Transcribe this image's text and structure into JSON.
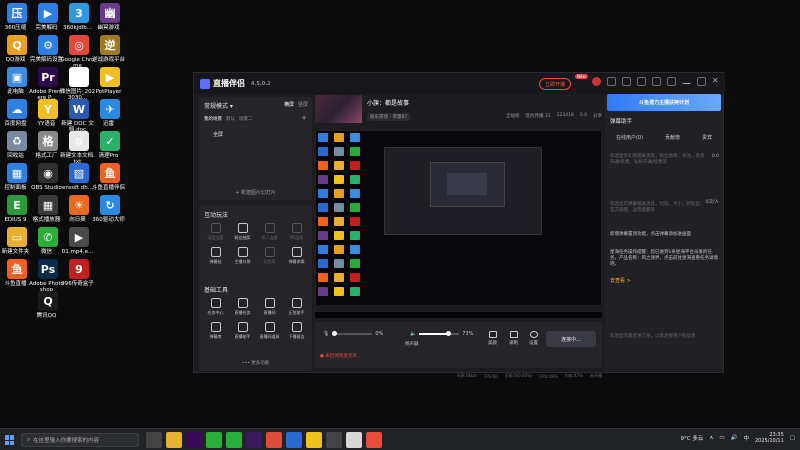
{
  "desktop": {
    "icons": [
      {
        "label": "360压缩",
        "color": "#2d7fe0",
        "glyph": "压"
      },
      {
        "label": "QQ游戏",
        "color": "#e8a020",
        "glyph": "Q"
      },
      {
        "label": "此电脑",
        "color": "#3b8be0",
        "glyph": "▣"
      },
      {
        "label": "百度网盘",
        "color": "#2d7fe0",
        "glyph": "☁"
      },
      {
        "label": "回收站",
        "color": "#7a8aa0",
        "glyph": "♻"
      },
      {
        "label": "控制面板",
        "color": "#2d7fe0",
        "glyph": "▦"
      },
      {
        "label": "EDIUS 9",
        "color": "#2a9a3a",
        "glyph": "E"
      },
      {
        "label": "新建文件夹",
        "color": "#e8b030",
        "glyph": "▭"
      },
      {
        "label": "斗鱼直播",
        "color": "#f06020",
        "glyph": "鱼"
      },
      {
        "label": "完美解码",
        "color": "#2d7fe0",
        "glyph": "▶"
      },
      {
        "label": "完美解码设置",
        "color": "#2d7fe0",
        "glyph": "⚙"
      },
      {
        "label": "Adobe Premiere P...",
        "color": "#2a0a4a",
        "glyph": "Pr"
      },
      {
        "label": "YY语音",
        "color": "#f0c020",
        "glyph": "Y"
      },
      {
        "label": "格式工厂",
        "color": "#8a8a8a",
        "glyph": "格"
      },
      {
        "label": "OBS Studio",
        "color": "#302e31",
        "glyph": "◉"
      },
      {
        "label": "格式播放器",
        "color": "#3a3a3a",
        "glyph": "▦"
      },
      {
        "label": "微信",
        "color": "#2aae3a",
        "glyph": "✆"
      },
      {
        "label": "Adobe Photoshop",
        "color": "#0a2a4a",
        "glyph": "Ps"
      },
      {
        "label": "腾讯QQ",
        "color": "#1a1a1a",
        "glyph": "Q"
      },
      {
        "label": "360kjdlb...",
        "color": "#2d9ae0",
        "glyph": "3"
      },
      {
        "label": "Google Chrome",
        "color": "#e04a3a",
        "glyph": "◎"
      },
      {
        "label": "微信图片_2023030...",
        "color": "#ffffff",
        "glyph": ""
      },
      {
        "label": "新建 DOC 文档.doc",
        "color": "#2a5ab0",
        "glyph": "W"
      },
      {
        "label": "新建文本文档.txt",
        "color": "#e8e8e8",
        "glyph": "≡"
      },
      {
        "label": "ensoft dh...",
        "color": "#2a6ad0",
        "glyph": "▧"
      },
      {
        "label": "向日葵",
        "color": "#e86a20",
        "glyph": "☀"
      },
      {
        "label": "01.mp4.e...",
        "color": "#4a4a4a",
        "glyph": "▶"
      },
      {
        "label": "996传奇盒子",
        "color": "#c02020",
        "glyph": "9"
      },
      {
        "label": "幽冥游戏",
        "color": "#6a3a8a",
        "glyph": "幽"
      },
      {
        "label": "逆战游戏平台",
        "color": "#a07a20",
        "glyph": "逆"
      },
      {
        "label": "PotPlayer",
        "color": "#f0c020",
        "glyph": "▶"
      },
      {
        "label": "迅雷",
        "color": "#2a8ae0",
        "glyph": "✈"
      },
      {
        "label": "清理Pro",
        "color": "#2ab06a",
        "glyph": "✓"
      },
      {
        "label": "斗鱼直播伴侣",
        "color": "#f06020",
        "glyph": "鱼"
      },
      {
        "label": "360驱动大师",
        "color": "#2a8ae0",
        "glyph": "↻"
      }
    ]
  },
  "app": {
    "name": "直播伴侣",
    "version": "4.5.0.2",
    "live_button": "立即开播",
    "new_badge": "New",
    "left": {
      "mode": "常规模式 ▾",
      "mode_tabs": [
        "横屏",
        "竖屏"
      ],
      "scene_tabs": [
        "我的场景",
        "默认",
        "场景二"
      ],
      "scene_item": "全屏",
      "add_scene": "+ 新建图片幻灯片",
      "interact_title": "互动玩法",
      "interact_items": [
        {
          "label": "语音连麦",
          "dim": true
        },
        {
          "label": "粉丝抽奖",
          "dim": false
        },
        {
          "label": "多人连麦",
          "dim": true
        },
        {
          "label": "PK连线",
          "dim": true
        },
        {
          "label": "弹幕挂",
          "dim": false
        },
        {
          "label": "主播口袋",
          "dim": false
        },
        {
          "label": "红包雨",
          "dim": true
        },
        {
          "label": "弹幕求歌",
          "dim": false
        }
      ],
      "tools_title": "基础工具",
      "tools_items": [
        {
          "label": "任务中心",
          "dim": false
        },
        {
          "label": "直播任务",
          "dim": false
        },
        {
          "label": "直播间",
          "dim": false
        },
        {
          "label": "正弦助手",
          "dim": false
        },
        {
          "label": "弹幕库",
          "dim": false
        },
        {
          "label": "直播助手",
          "dim": false
        },
        {
          "label": "直播间道具",
          "dim": false
        },
        {
          "label": "下播报告",
          "dim": false
        }
      ],
      "more": "••• 更多功能"
    },
    "center": {
      "room_title": "小旗：都是故事",
      "category": "极乐游戏 - 草量87",
      "stats": [
        "全站榜",
        "签约月播 31",
        "223418",
        "0.0",
        "分享"
      ],
      "mic_value": "0%",
      "speaker_value": "73%",
      "mic_label": "麦克风",
      "speaker_label": "扬声器",
      "ctl": [
        "美颜",
        "录制",
        "设置"
      ],
      "connect_button": "连接中...",
      "warn": "● 未检测到麦克风",
      "status": [
        "码率:0kb/s",
        "FPS:60",
        "丢帧:0(0.00%)",
        "CPU:19%",
        "内存:47%",
        "未开播"
      ]
    },
    "right": {
      "banner": "斗鱼潜力主播扶持计划",
      "title": "弹幕助手",
      "tabs": [
        "在线用户(0)",
        "贡献榜",
        "贵宾"
      ],
      "text1": "欢迎显示礼物相关消息，粉丝勋章、关注、贵族开通/续费、钻粉开通/续费等",
      "text2": "欢迎显示弹幕相关消息，包括、大小、新粉丝、官方提醒、运营提醒等",
      "text3": "新增弹幕置顶功能，点击弹幕添加进画面",
      "text4": "星海任务操作提醒：您已收到1条星海平台派发的任务，产品名称：风之领界，点击前往星海查看任务详情吧。",
      "link": "去查看 >",
      "text5": "欢迎显示最近进了你，以及连接用户的信息",
      "count1": "0.0",
      "count2": "0次/人"
    }
  },
  "taskbar": {
    "search_placeholder": "在这里输入你要搜索的内容",
    "weather": "9°C 多云",
    "time": "23:35",
    "date": "2025/10/11"
  }
}
